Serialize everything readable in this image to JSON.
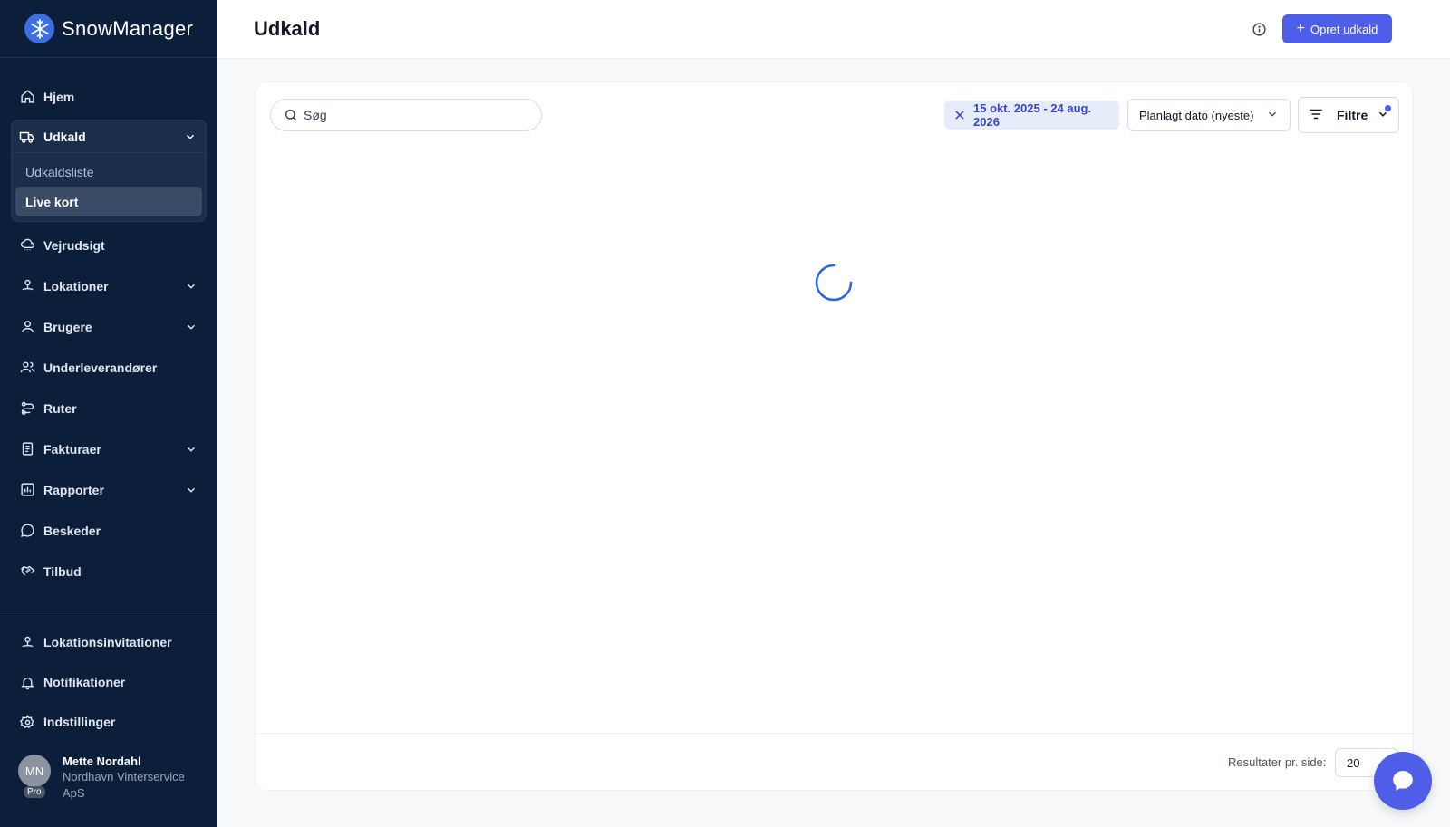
{
  "app": {
    "name": "SnowManager"
  },
  "sidebar": {
    "items": [
      {
        "label": "Hjem"
      },
      {
        "label": "Udkald",
        "expanded": true,
        "children": [
          {
            "label": "Udkaldsliste"
          },
          {
            "label": "Live kort",
            "active": true
          }
        ]
      },
      {
        "label": "Vejrudsigt"
      },
      {
        "label": "Lokationer"
      },
      {
        "label": "Brugere"
      },
      {
        "label": "Underleverandører"
      },
      {
        "label": "Ruter"
      },
      {
        "label": "Fakturaer"
      },
      {
        "label": "Rapporter"
      },
      {
        "label": "Beskeder"
      },
      {
        "label": "Tilbud"
      }
    ],
    "bottom_items": [
      {
        "label": "Lokationsinvitationer"
      },
      {
        "label": "Notifikationer"
      },
      {
        "label": "Indstillinger"
      }
    ],
    "user": {
      "initials": "MN",
      "badge": "Pro",
      "name": "Mette Nordahl",
      "company": "Nordhavn Vinterservice ApS"
    }
  },
  "header": {
    "title": "Udkald",
    "create_label": "Opret udkald"
  },
  "toolbar": {
    "search_placeholder": "Søg",
    "date_filter": "15 okt. 2025 - 24 aug. 2026",
    "sort_label": "Planlagt dato (nyeste)",
    "filter_label": "Filtre"
  },
  "footer": {
    "per_page_label": "Resultater pr. side:",
    "per_page_value": "20"
  },
  "colors": {
    "sidebar_bg": "#0b1f3b",
    "accent": "#4f5ee8",
    "spinner": "#2563eb"
  }
}
